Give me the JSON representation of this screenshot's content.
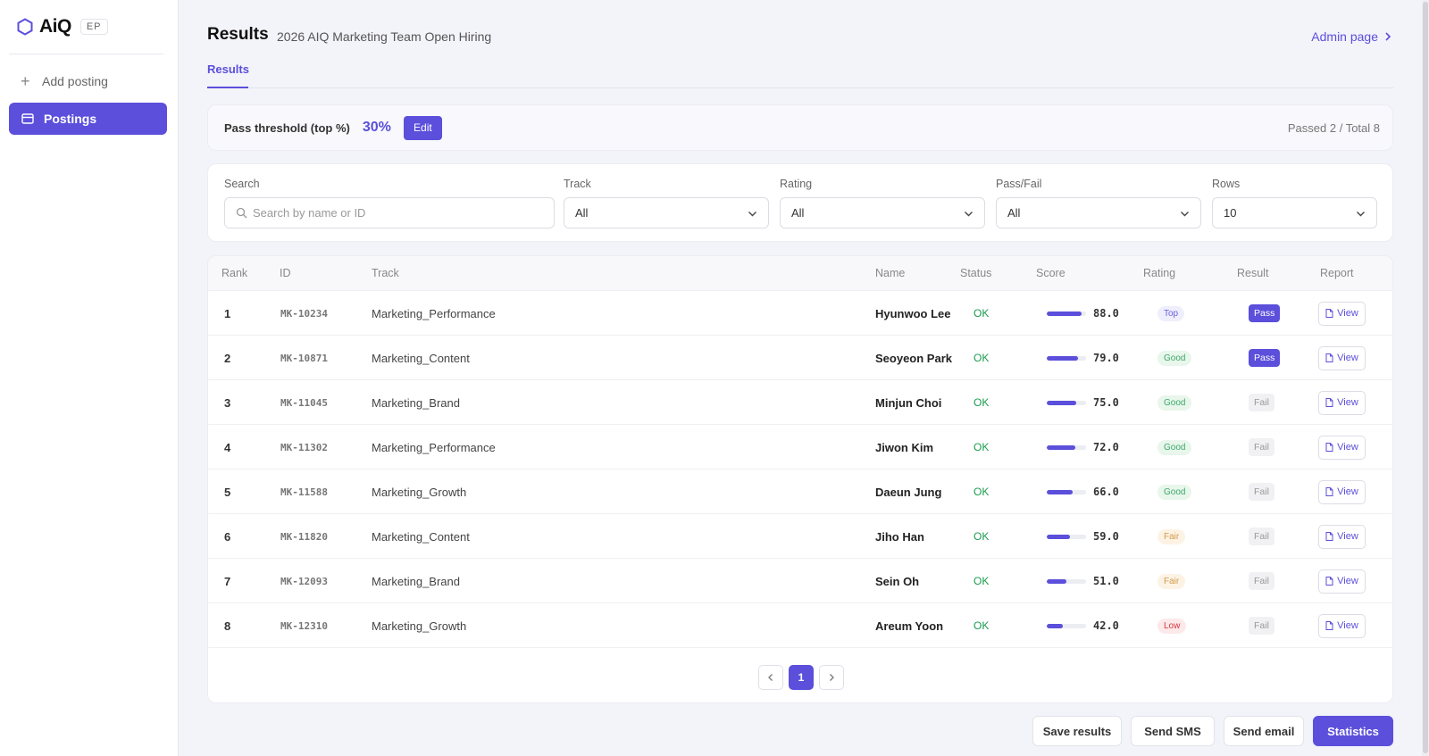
{
  "brand": {
    "name": "AiQ",
    "badge": "EP"
  },
  "sidebar": {
    "add_label": "Add posting",
    "postings_label": "Postings"
  },
  "header": {
    "title": "Results",
    "subtitle": "2026 AIQ Marketing Team Open Hiring",
    "admin_link": "Admin page"
  },
  "tabs": [
    {
      "label": "Results",
      "active": true
    }
  ],
  "threshold": {
    "label": "Pass threshold (top %)",
    "value": "30%",
    "edit_label": "Edit",
    "summary": "Passed 2 / Total 8"
  },
  "filters": {
    "search": {
      "label": "Search",
      "placeholder": "Search by name or ID"
    },
    "track": {
      "label": "Track",
      "value": "All"
    },
    "rating": {
      "label": "Rating",
      "value": "All"
    },
    "passfail": {
      "label": "Pass/Fail",
      "value": "All"
    },
    "rows": {
      "label": "Rows",
      "value": "10"
    }
  },
  "table": {
    "columns": [
      "Rank",
      "ID",
      "Track",
      "Name",
      "Status",
      "Score",
      "Rating",
      "Result",
      "Report"
    ],
    "view_label": "View",
    "rows": [
      {
        "rank": "1",
        "id": "MK-10234",
        "track": "Marketing_Performance",
        "name": "Hyunwoo Lee",
        "status": "OK",
        "score": "88.0",
        "rating": "Top",
        "result": "Pass"
      },
      {
        "rank": "2",
        "id": "MK-10871",
        "track": "Marketing_Content",
        "name": "Seoyeon Park",
        "status": "OK",
        "score": "79.0",
        "rating": "Good",
        "result": "Pass"
      },
      {
        "rank": "3",
        "id": "MK-11045",
        "track": "Marketing_Brand",
        "name": "Minjun Choi",
        "status": "OK",
        "score": "75.0",
        "rating": "Good",
        "result": "Fail"
      },
      {
        "rank": "4",
        "id": "MK-11302",
        "track": "Marketing_Performance",
        "name": "Jiwon Kim",
        "status": "OK",
        "score": "72.0",
        "rating": "Good",
        "result": "Fail"
      },
      {
        "rank": "5",
        "id": "MK-11588",
        "track": "Marketing_Growth",
        "name": "Daeun Jung",
        "status": "OK",
        "score": "66.0",
        "rating": "Good",
        "result": "Fail"
      },
      {
        "rank": "6",
        "id": "MK-11820",
        "track": "Marketing_Content",
        "name": "Jiho Han",
        "status": "OK",
        "score": "59.0",
        "rating": "Fair",
        "result": "Fail"
      },
      {
        "rank": "7",
        "id": "MK-12093",
        "track": "Marketing_Brand",
        "name": "Sein Oh",
        "status": "OK",
        "score": "51.0",
        "rating": "Fair",
        "result": "Fail"
      },
      {
        "rank": "8",
        "id": "MK-12310",
        "track": "Marketing_Growth",
        "name": "Areum Yoon",
        "status": "OK",
        "score": "42.0",
        "rating": "Low",
        "result": "Fail"
      }
    ]
  },
  "pagination": {
    "current": "1"
  },
  "actions": {
    "save": "Save results",
    "sms": "Send SMS",
    "email": "Send email",
    "stats": "Statistics"
  },
  "colors": {
    "accent": "#5b4fdb",
    "ok": "#1a9b4f",
    "low": "#d9363e"
  }
}
